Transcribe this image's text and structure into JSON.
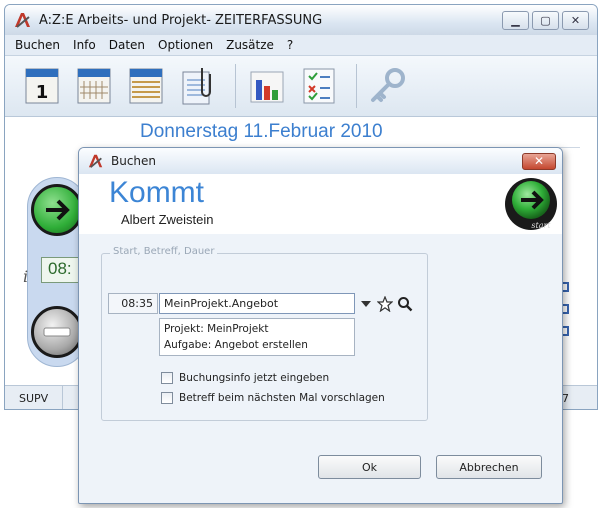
{
  "main_window": {
    "title": "A:Z:E Arbeits- und Projekt- ZEITERFASSUNG",
    "menu": [
      "Buchen",
      "Info",
      "Daten",
      "Optionen",
      "Zusätze",
      "?"
    ],
    "toolbar_icons": [
      "calendar-day-icon",
      "calendar-week-icon",
      "calendar-month-icon",
      "notes-clip-icon",
      "bar-chart-icon",
      "checklist-icon",
      "key-icon"
    ],
    "date_header": "Donnerstag 11.Februar 2010",
    "info_letter": "i",
    "clock_time": "08:",
    "status_left": "SUPV",
    "status_right": "7"
  },
  "dialog": {
    "title": "Buchen",
    "close_glyph": "✕",
    "heading": "Kommt",
    "user": "Albert Zweistein",
    "group_label": "Start, Betreff, Dauer",
    "time": "08:35",
    "project_value": "MeinProjekt.Angebot",
    "description_lines": [
      "Projekt: MeinProjekt",
      "Aufgabe: Angebot erstellen"
    ],
    "checkbox_info": "Buchungsinfo jetzt eingeben",
    "checkbox_suggest": "Betreff beim nächsten Mal vorschlagen",
    "ok_label": "Ok",
    "cancel_label": "Abbrechen",
    "start_badge": "start"
  },
  "colors": {
    "accent_blue": "#3c85d5",
    "start_green": "#2fae38",
    "close_red": "#c4472f"
  }
}
